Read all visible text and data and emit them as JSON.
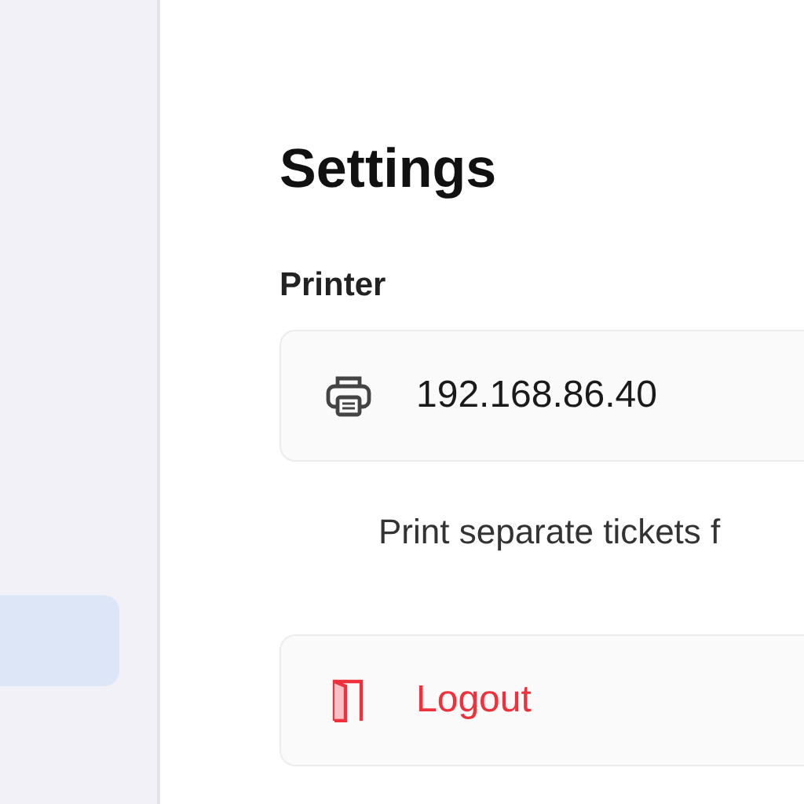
{
  "sidebar": {
    "items": [
      {
        "selected": true
      }
    ]
  },
  "title": "Settings",
  "printer": {
    "label": "Printer",
    "address": "192.168.86.40",
    "note": "Print separate tickets f"
  },
  "logout": {
    "label": "Logout"
  }
}
